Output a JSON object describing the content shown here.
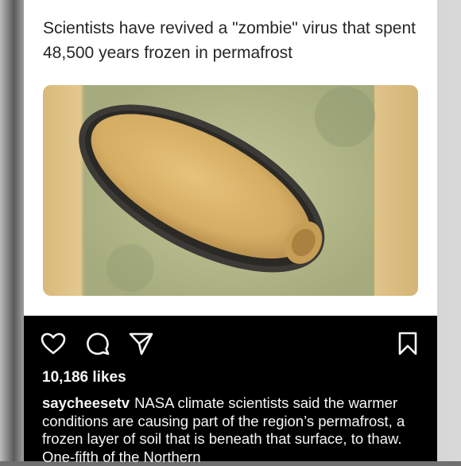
{
  "post": {
    "headline": "Scientists have revived a \"zombie\" virus that spent 48,500 years frozen in permafrost",
    "image_alt": "virus micrograph",
    "likes_text": "10,186 likes",
    "caption": {
      "username": "saycheesetv",
      "text": "NASA climate scientists said the warmer conditions are causing part of the region’s permafrost, a frozen layer of soil that is beneath that surface, to thaw. One-fifth of the Northern"
    }
  },
  "icons": {
    "like": "heart-icon",
    "comment": "comment-icon",
    "share": "share-icon",
    "save": "bookmark-icon"
  },
  "colors": {
    "post_background": "#ffffff",
    "dark_panel": "#000000",
    "text_dark": "#262626",
    "text_light": "#f5f5f5"
  }
}
